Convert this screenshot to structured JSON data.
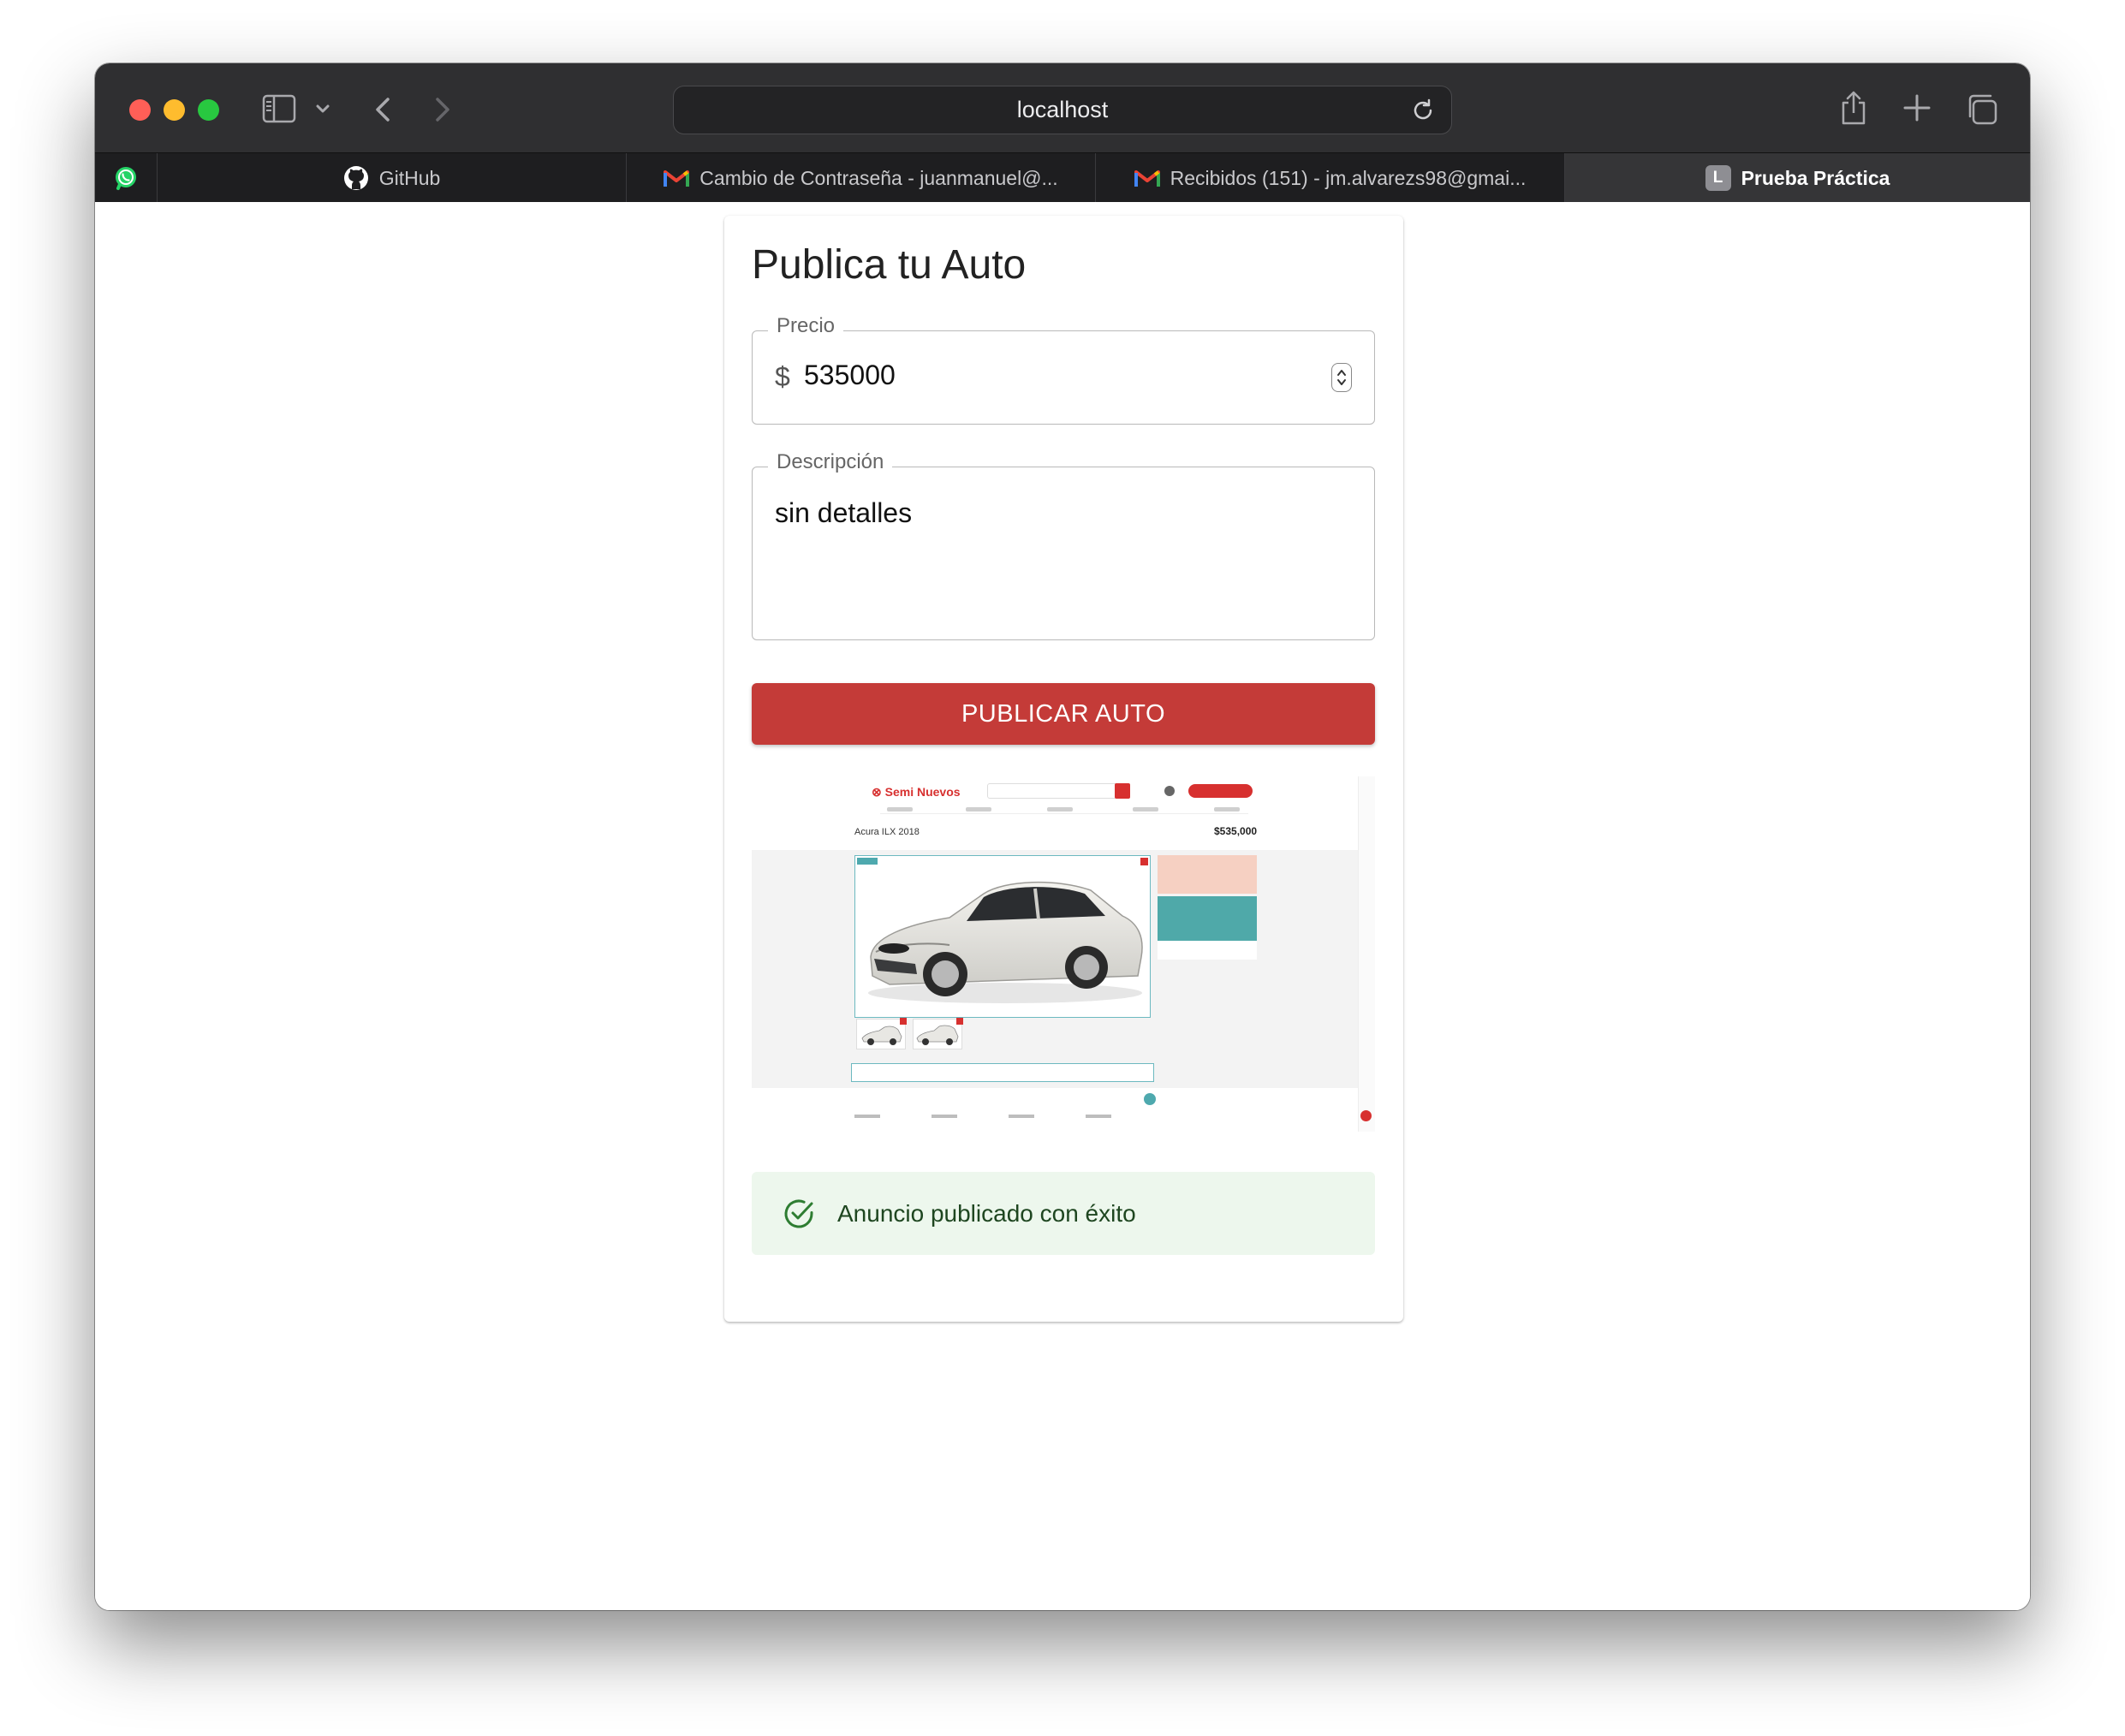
{
  "browser": {
    "url": "localhost",
    "tabs": [
      {
        "label": "",
        "icon": "whatsapp-icon"
      },
      {
        "label": "GitHub",
        "icon": "github-icon"
      },
      {
        "label": "Cambio de Contraseña - juanmanuel@...",
        "icon": "gmail-icon"
      },
      {
        "label": "Recibidos (151) - jm.alvarezs98@gmai...",
        "icon": "gmail-icon"
      },
      {
        "label": "Prueba Práctica",
        "icon": "l-badge-icon",
        "badge": "L",
        "active": true
      }
    ]
  },
  "form": {
    "title": "Publica tu Auto",
    "price": {
      "label": "Precio",
      "prefix": "$",
      "value": "535000"
    },
    "description": {
      "label": "Descripción",
      "value": "sin detalles"
    },
    "submit_label": "PUBLICAR AUTO"
  },
  "preview": {
    "site_name": "Semi Nuevos",
    "car_title": "Acura ILX 2018",
    "car_price": "$535,000"
  },
  "alert": {
    "message": "Anuncio publicado con éxito",
    "icon": "check-circle-icon"
  },
  "colors": {
    "accent": "#c43b38",
    "success_bg": "#edf7ed",
    "success_text": "#1e4620",
    "success_icon": "#2e7d32"
  }
}
